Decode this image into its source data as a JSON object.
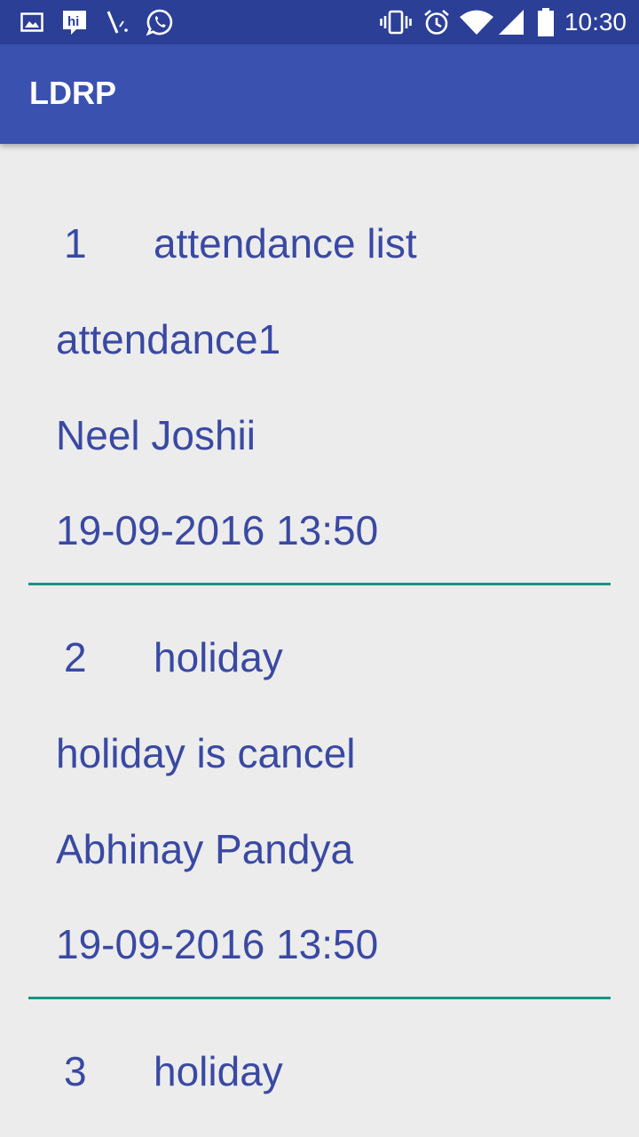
{
  "status_bar": {
    "time": "10:30",
    "left_icons": [
      "image-icon",
      "hike-messenger-icon",
      "signal-tool-icon",
      "whatsapp-icon"
    ],
    "right_icons": [
      "vibrate-icon",
      "alarm-icon",
      "wifi-icon",
      "cell-signal-icon",
      "battery-icon"
    ]
  },
  "app_bar": {
    "title": "LDRP",
    "color": "#3b51b0"
  },
  "colors": {
    "text": "#3949a3",
    "divider": "#199385",
    "background": "#ececec",
    "status_bar": "#2b3f97"
  },
  "items": [
    {
      "number": "1",
      "title": "attendance list",
      "description": "attendance1",
      "author": "Neel Joshii",
      "date": "19-09-2016 13:50"
    },
    {
      "number": "2",
      "title": "holiday",
      "description": "holiday is cancel",
      "author": "Abhinay Pandya",
      "date": "19-09-2016 13:50"
    },
    {
      "number": "3",
      "title": "holiday"
    }
  ]
}
